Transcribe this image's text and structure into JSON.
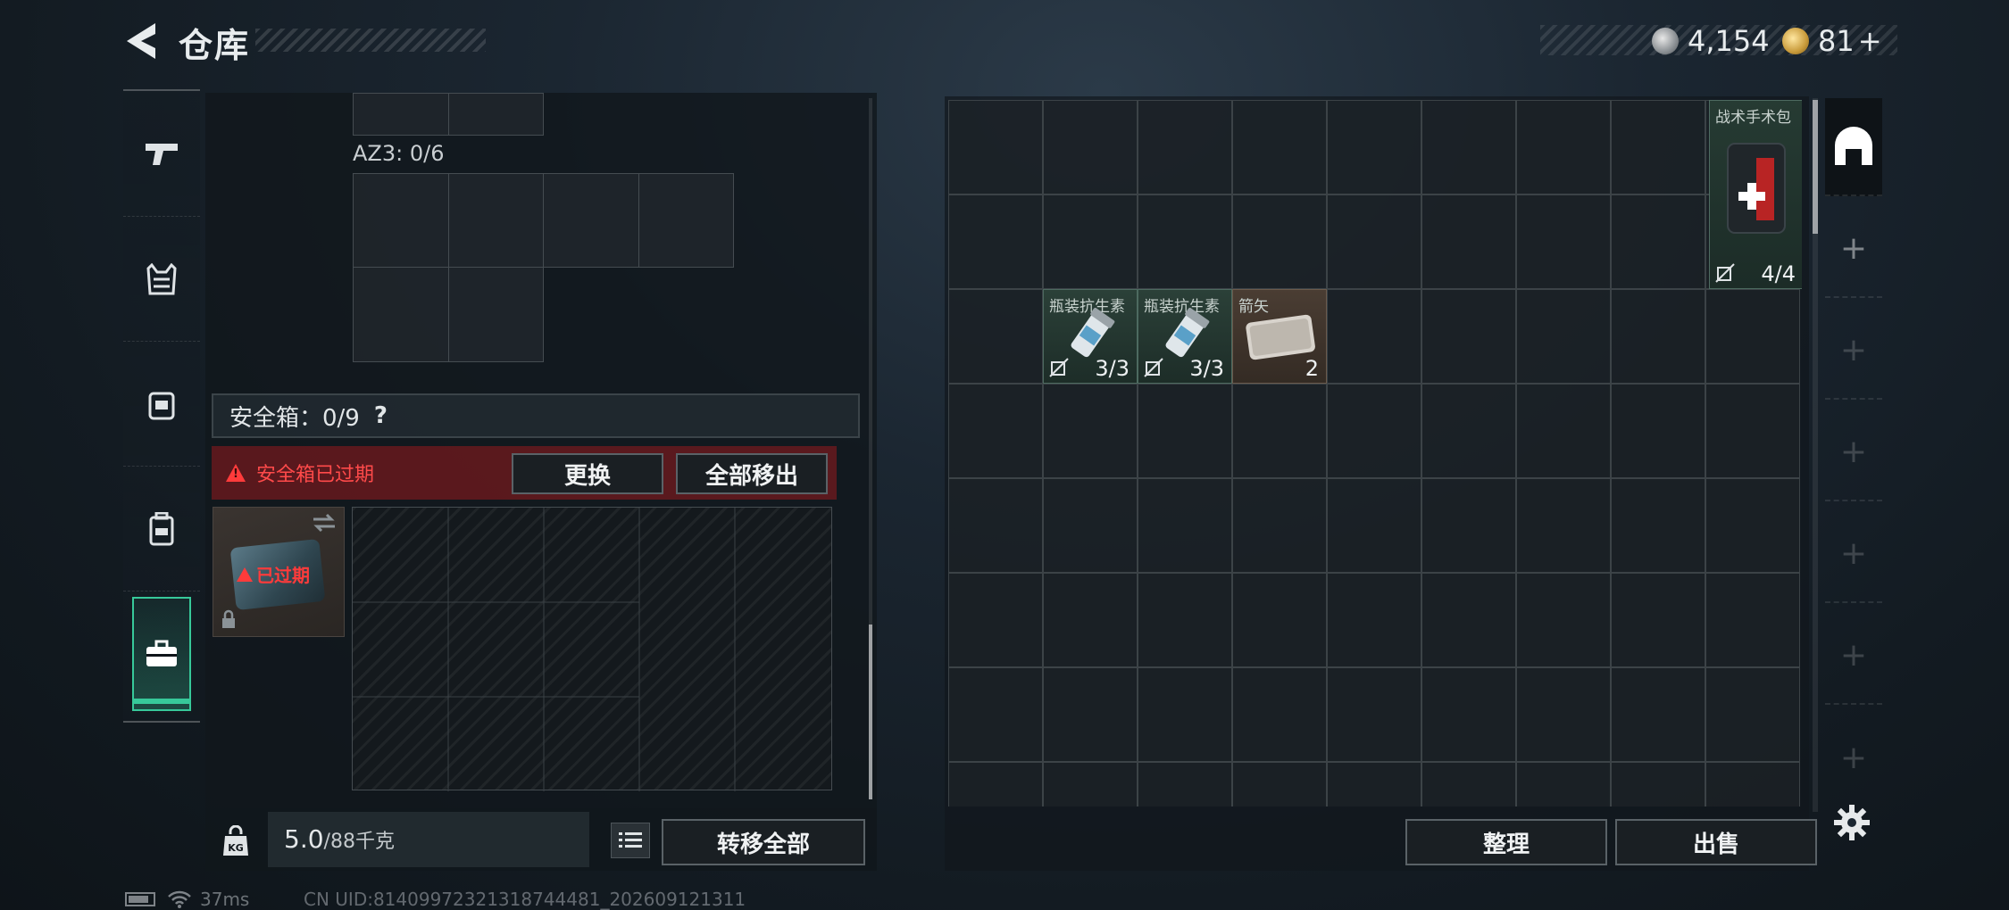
{
  "header": {
    "title": "仓库"
  },
  "currency": {
    "silver": "4,154",
    "gold": "81",
    "gold_add": "+"
  },
  "categories": [
    "weapon",
    "armor",
    "chest-rig",
    "backpack",
    "safe-box"
  ],
  "left": {
    "az_label": "AZ3: 0/6",
    "safe_label": "安全箱：0/9",
    "help": "?",
    "expired_notice": "安全箱已过期",
    "replace_btn": "更换",
    "move_all_btn": "全部移出",
    "safe_status": "已过期",
    "weight_value": "5.0",
    "weight_max": "/88千克",
    "transfer_all_btn": "转移全部"
  },
  "stash": {
    "items": [
      {
        "name": "战术手术包",
        "count": "4/4"
      },
      {
        "name": "瓶装抗生素",
        "count": "3/3"
      },
      {
        "name": "瓶装抗生素",
        "count": "3/3"
      },
      {
        "name": "箭矢",
        "count": "2"
      }
    ],
    "sort_btn": "整理",
    "sell_btn": "出售"
  },
  "side_plus": "+",
  "status": {
    "ping": "37ms",
    "uid": "CN UID:81409972321318744481_202609121311"
  },
  "colors": {
    "accent": "#37c99a",
    "danger": "#ff3b3b",
    "panel": "#11171c"
  }
}
